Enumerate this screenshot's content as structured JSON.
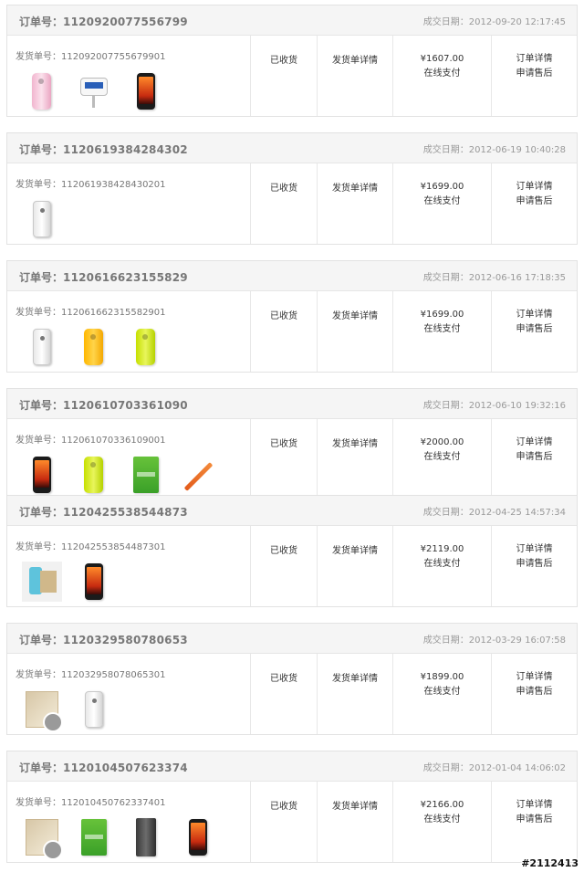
{
  "labels": {
    "order_no": "订单号：",
    "date": "成交日期：",
    "ship_no": "发货单号：",
    "ship_detail": "发货单详情",
    "order_detail": "订单详情",
    "after_sale": "申请售后"
  },
  "orders": [
    {
      "order_no": "1120920077556799",
      "date": "2012-09-20 12:17:45",
      "ship_no": "112092007755679901",
      "status": "已收货",
      "price": "¥1607.00",
      "pay": "在线支付",
      "items": [
        "pink-case-icon",
        "charger-icon",
        "black-phone-icon"
      ]
    },
    {
      "order_no": "1120619384284302",
      "date": "2012-06-19 10:40:28",
      "ship_no": "112061938428430201",
      "status": "已收货",
      "price": "¥1699.00",
      "pay": "在线支付",
      "items": [
        "white-phone-icon"
      ]
    },
    {
      "order_no": "1120616623155829",
      "date": "2012-06-16 17:18:35",
      "ship_no": "112061662315582901",
      "status": "已收货",
      "price": "¥1699.00",
      "pay": "在线支付",
      "items": [
        "white-phone-icon",
        "yellow-case-icon",
        "lime-case-icon"
      ]
    },
    {
      "order_no": "1120610703361090",
      "date": "2012-06-10 19:32:16",
      "ship_no": "112061070336109001",
      "status": "已收货",
      "price": "¥2000.00",
      "pay": "在线支付",
      "items": [
        "black-phone-icon",
        "lime-case-icon",
        "battery-icon",
        "stylus-icon"
      ]
    },
    {
      "order_no": "1120425538544873",
      "date": "2012-04-25 14:57:34",
      "ship_no": "112042553854487301",
      "status": "已收货",
      "price": "¥2119.00",
      "pay": "在线支付",
      "items": [
        "accessory-combo-icon",
        "black-phone-icon"
      ]
    },
    {
      "order_no": "1120329580780653",
      "date": "2012-03-29 16:07:58",
      "ship_no": "112032958078065301",
      "status": "已收货",
      "price": "¥1899.00",
      "pay": "在线支付",
      "items": [
        "gift-box-icon",
        "white-phone-icon"
      ]
    },
    {
      "order_no": "1120104507623374",
      "date": "2012-01-04 14:06:02",
      "ship_no": "112010450762337401",
      "status": "已收货",
      "price": "¥2166.00",
      "pay": "在线支付",
      "items": [
        "gift-box-icon",
        "battery-icon",
        "dark-case-icon",
        "black-phone-icon"
      ]
    }
  ],
  "watermark": "#2112413"
}
